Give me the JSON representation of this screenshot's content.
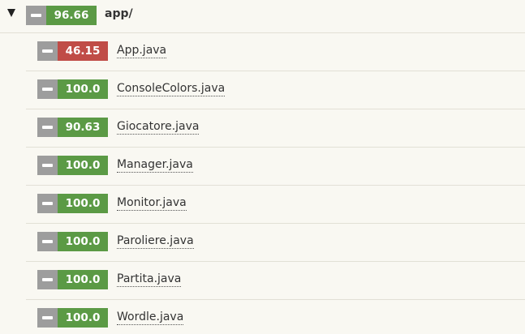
{
  "root": {
    "label": "app/",
    "score": "96.66",
    "score_color": "#5b9a45"
  },
  "files": [
    {
      "name": "App.java",
      "score": "46.15",
      "color": "#c04c47"
    },
    {
      "name": "ConsoleColors.java",
      "score": "100.0",
      "color": "#5b9a45"
    },
    {
      "name": "Giocatore.java",
      "score": "90.63",
      "color": "#5b9a45"
    },
    {
      "name": "Manager.java",
      "score": "100.0",
      "color": "#5b9a45"
    },
    {
      "name": "Monitor.java",
      "score": "100.0",
      "color": "#5b9a45"
    },
    {
      "name": "Paroliere.java",
      "score": "100.0",
      "color": "#5b9a45"
    },
    {
      "name": "Partita.java",
      "score": "100.0",
      "color": "#5b9a45"
    },
    {
      "name": "Wordle.java",
      "score": "100.0",
      "color": "#5b9a45"
    }
  ],
  "icons": {
    "toggle": "triangle-down-icon",
    "collapse": "minus-icon"
  }
}
